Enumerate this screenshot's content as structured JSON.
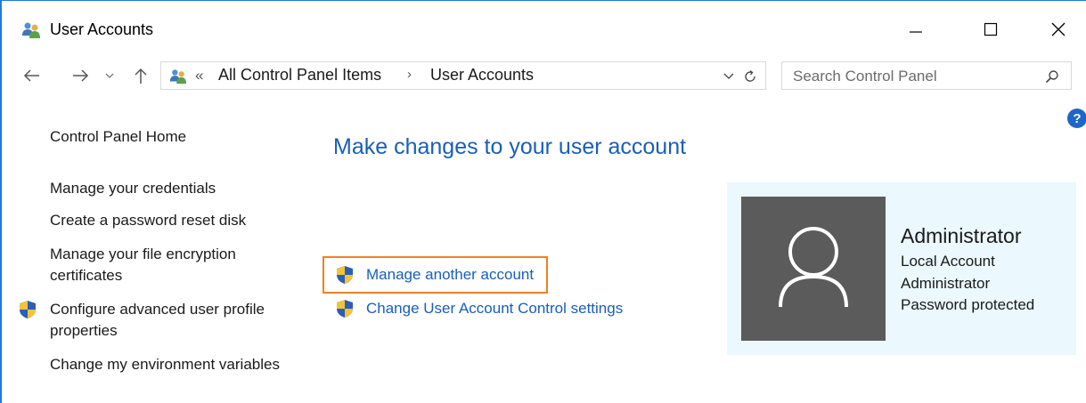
{
  "window": {
    "title": "User Accounts"
  },
  "address_bar": {
    "crumbs": [
      "All Control Panel Items",
      "User Accounts"
    ],
    "overflow_glyph": "«",
    "separator": "›"
  },
  "search": {
    "placeholder": "Search Control Panel"
  },
  "left_pane": {
    "home": "Control Panel Home",
    "links": [
      "Manage your credentials",
      "Create a password reset disk",
      "Manage your file encryption certificates",
      "Configure advanced user profile properties",
      "Change my environment variables"
    ]
  },
  "main": {
    "heading": "Make changes to your user account",
    "tasks": [
      "Manage another account",
      "Change User Account Control settings"
    ]
  },
  "account": {
    "name": "Administrator",
    "details": [
      "Local Account",
      "Administrator",
      "Password protected"
    ]
  },
  "colors": {
    "link": "#1a5eb8",
    "highlight_border": "#f08020",
    "account_panel_bg": "#ebf8fd",
    "avatar_bg": "#5b5b5b",
    "window_border": "#1f7ad8"
  },
  "icons": {
    "app": "users-icon",
    "shield": "uac-shield-icon",
    "help": "help-icon"
  }
}
